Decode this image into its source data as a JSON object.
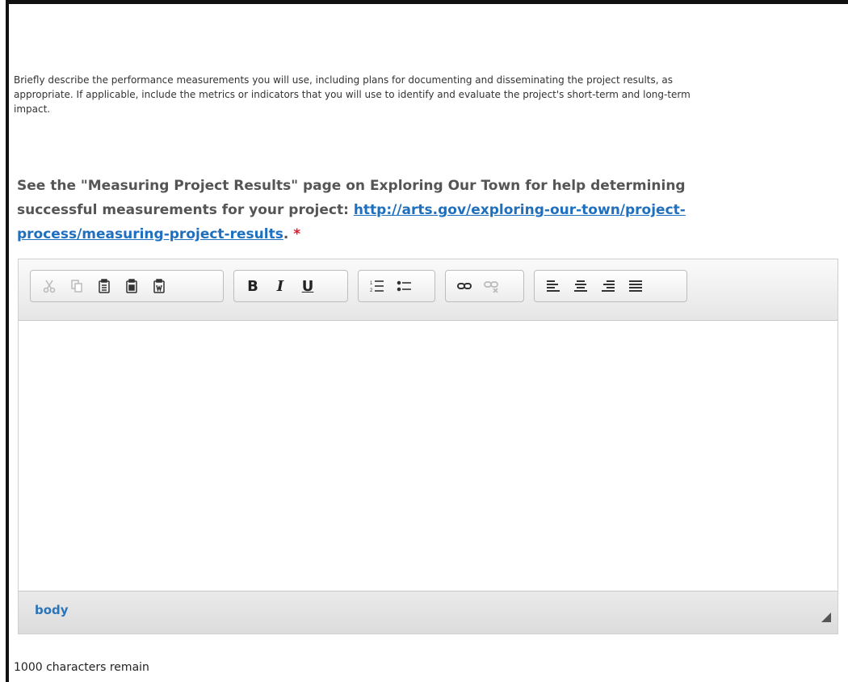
{
  "description": "Briefly describe the performance measurements you will use, including plans for documenting and disseminating the project results, as appropriate. If applicable, include the metrics or indicators that you will use to identify and evaluate the project's short-term and long-term impact.",
  "help": {
    "text": "See the \"Measuring Project Results\" page on Exploring Our Town for help determining successful measurements for your project: ",
    "link_text": "http://arts.gov/exploring-our-town/project-process/measuring-project-results",
    "suffix": ".",
    "required_marker": "*"
  },
  "toolbar": {
    "bold_label": "B",
    "italic_label": "I",
    "underline_label": "U",
    "icons": [
      "cut-icon",
      "copy-icon",
      "paste-icon",
      "paste-text-icon",
      "paste-word-icon",
      "ordered-list-icon",
      "bullet-list-icon",
      "link-icon",
      "unlink-icon",
      "align-left-icon",
      "align-center-icon",
      "align-right-icon",
      "justify-icon"
    ]
  },
  "editor": {
    "content": "",
    "path_label": "body"
  },
  "counter": "1000 characters remain",
  "colors": {
    "link": "#1f6fbf",
    "required": "#e0162b",
    "path": "#2a74b8"
  }
}
